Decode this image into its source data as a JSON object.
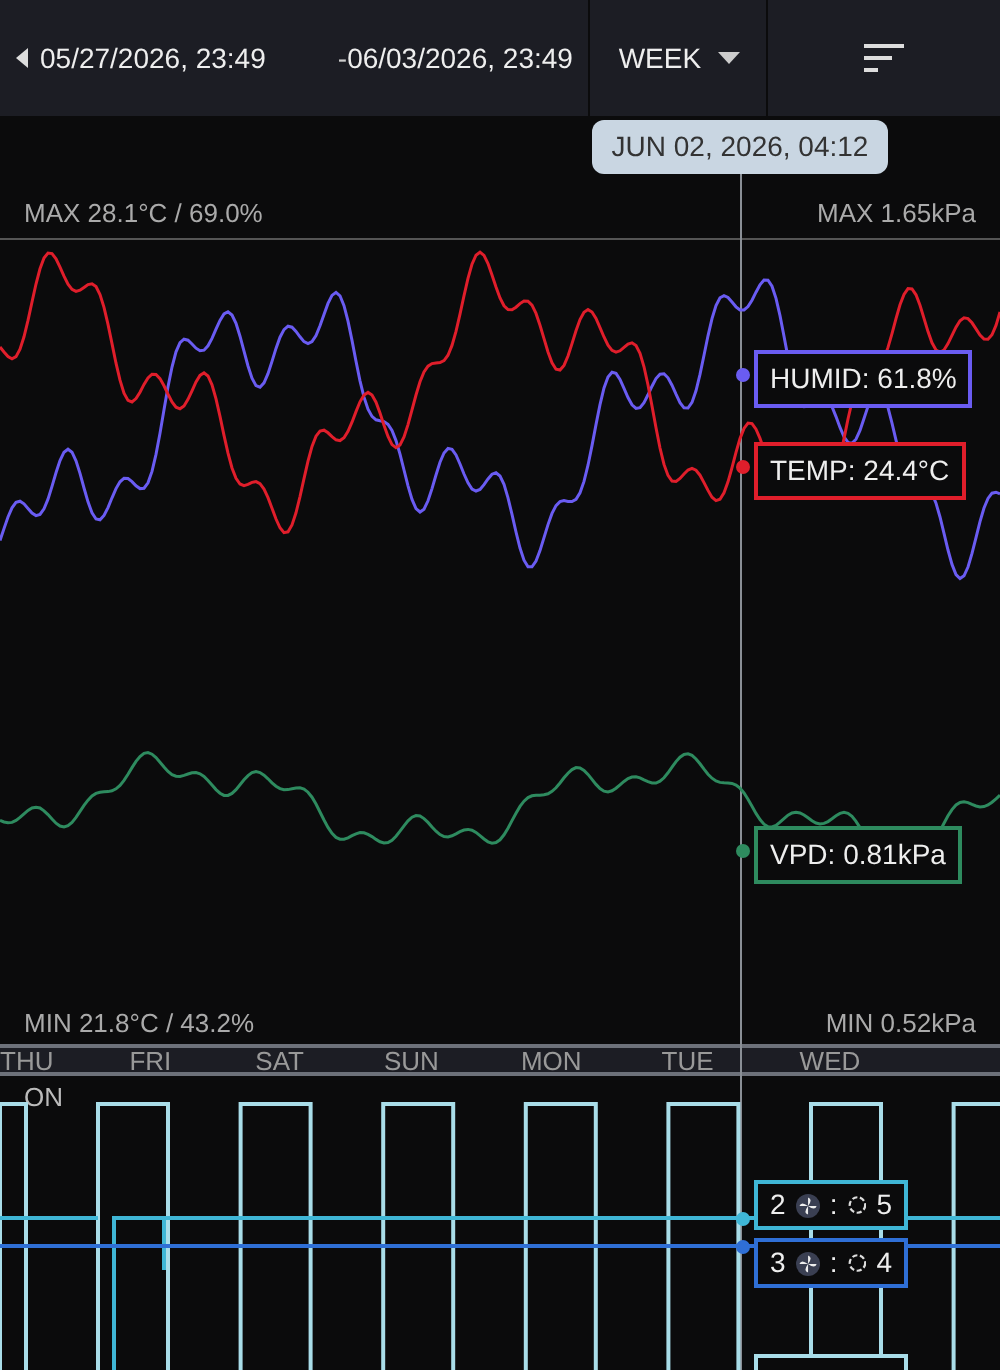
{
  "header": {
    "range_start": "05/27/2026, 23:49",
    "separator": "-",
    "range_end": "06/03/2026, 23:49",
    "period": "WEEK"
  },
  "cursor_time": "JUN 02, 2026, 04:12",
  "scale": {
    "max_left": "MAX 28.1°C / 69.0%",
    "max_right": "MAX 1.65kPa",
    "min_left": "MIN 21.8°C / 43.2%",
    "min_right": "MIN 0.52kPa"
  },
  "readouts": [
    {
      "label": "HUMID: 61.8%",
      "color": "#6a5cf2"
    },
    {
      "label": "TEMP: 24.4°C",
      "color": "#e01e2b"
    },
    {
      "label": "VPD: 0.81kPa",
      "color": "#2e8b5f"
    }
  ],
  "days": [
    "THU",
    "FRI",
    "SAT",
    "SUN",
    "MON",
    "TUE",
    "WED"
  ],
  "switch_label": "ON",
  "fan_readouts": [
    {
      "number": "2",
      "separator": ":",
      "value": "5",
      "color": "#3fb6d6"
    },
    {
      "number": "3",
      "separator": ":",
      "value": "4",
      "color": "#2f6fd6"
    }
  ]
}
